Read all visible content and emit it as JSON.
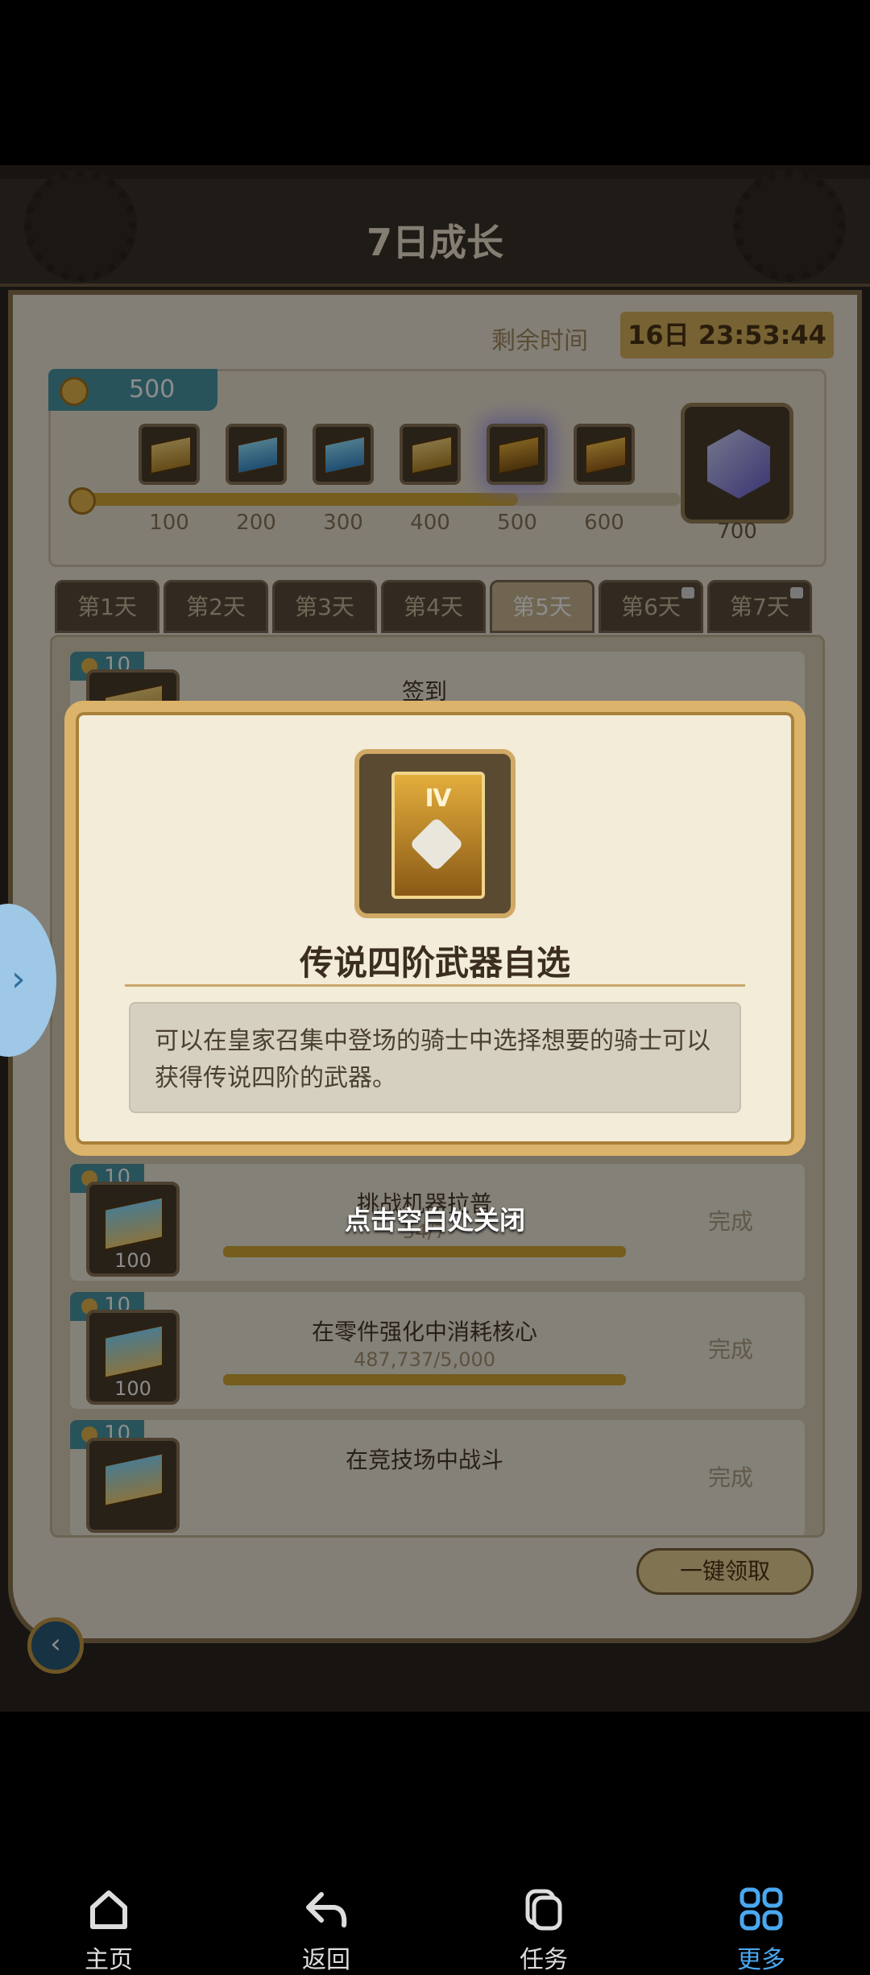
{
  "game": {
    "title": "7日成长",
    "remain_label": "剩余时间",
    "timer": "16日 23:53:44",
    "points": "500",
    "milestones": [
      "100",
      "200",
      "300",
      "400",
      "500",
      "600"
    ],
    "big_milestone": "700",
    "progress_percent": 73,
    "tabs": [
      "第1天",
      "第2天",
      "第3天",
      "第4天",
      "第5天",
      "第6天",
      "第7天"
    ],
    "active_tab": "第5天",
    "tasks": [
      {
        "pts": "10",
        "name": "签到",
        "progress": "",
        "qty": "",
        "done": ""
      },
      {
        "pts": "10",
        "name": "挑战机器拉普",
        "progress": "54/7",
        "qty": "100",
        "done": "完成"
      },
      {
        "pts": "10",
        "name": "在零件强化中消耗核心",
        "progress": "487,737/5,000",
        "qty": "100",
        "done": "完成"
      },
      {
        "pts": "10",
        "name": "在竞技场中战斗",
        "progress": "",
        "qty": "",
        "done": "完成"
      }
    ],
    "collect_all": "一键领取"
  },
  "dialog": {
    "item_numeral": "Ⅳ",
    "item_name": "传说四阶武器自选",
    "description": "可以在皇家召集中登场的骑士中选择想要的骑士可以获得传说四阶的武器。",
    "close_hint": "点击空白处关闭"
  },
  "nav": {
    "home": "主页",
    "back": "返回",
    "tasks": "任务",
    "more": "更多"
  },
  "colors": {
    "accent": "#4aa8f0",
    "gold": "#d4a936",
    "teal": "#4c97a6"
  }
}
